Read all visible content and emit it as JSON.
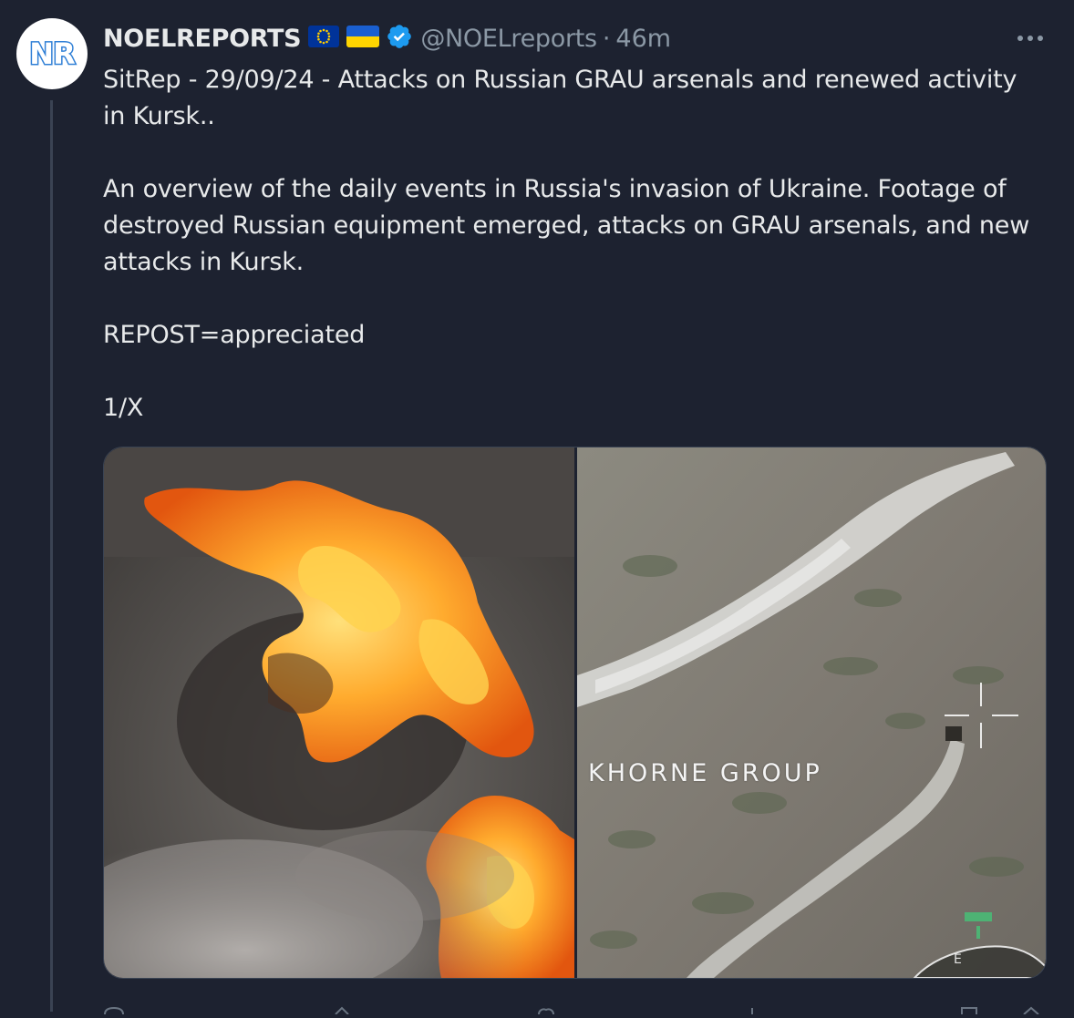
{
  "tweet": {
    "avatar_initials": "NR",
    "display_name": "NOELREPORTS",
    "handle": "@NOELreports",
    "separator": "·",
    "time": "46m",
    "more_icon": "more-horizontal-icon",
    "body": [
      "SitRep - 29/09/24 - Attacks on Russian GRAU arsenals and renewed activity in Kursk..",
      "An overview of the daily events in Russia's invasion of Ukraine. Footage of destroyed Russian equipment emerged, attacks on GRAU arsenals, and new attacks in Kursk.",
      "REPOST=appreciated",
      "1/X"
    ],
    "media": {
      "right_watermark": "KHORNE GROUP"
    }
  },
  "colors": {
    "background": "#1d2230",
    "text": "#e7e9ea",
    "secondary_text": "#8b98a5",
    "verified": "#1d9bf0",
    "avatar_brand": "#2f7fd6"
  }
}
